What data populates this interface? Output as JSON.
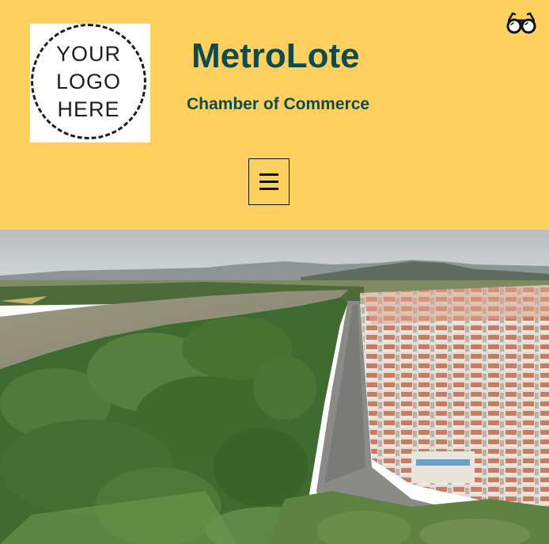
{
  "header": {
    "logo": {
      "lines": [
        "YOUR",
        "LOGO",
        "HERE"
      ]
    },
    "title": "MetroLote",
    "subtitle": "Chamber of Commerce",
    "accessibility_icon": "glasses-icon",
    "menu_icon": "hamburger-menu-icon"
  },
  "hero": {
    "image": "aerial-photo-river-forest-housing"
  },
  "colors": {
    "header_bg": "#fdd060",
    "brand_text": "#0d4b4f"
  }
}
